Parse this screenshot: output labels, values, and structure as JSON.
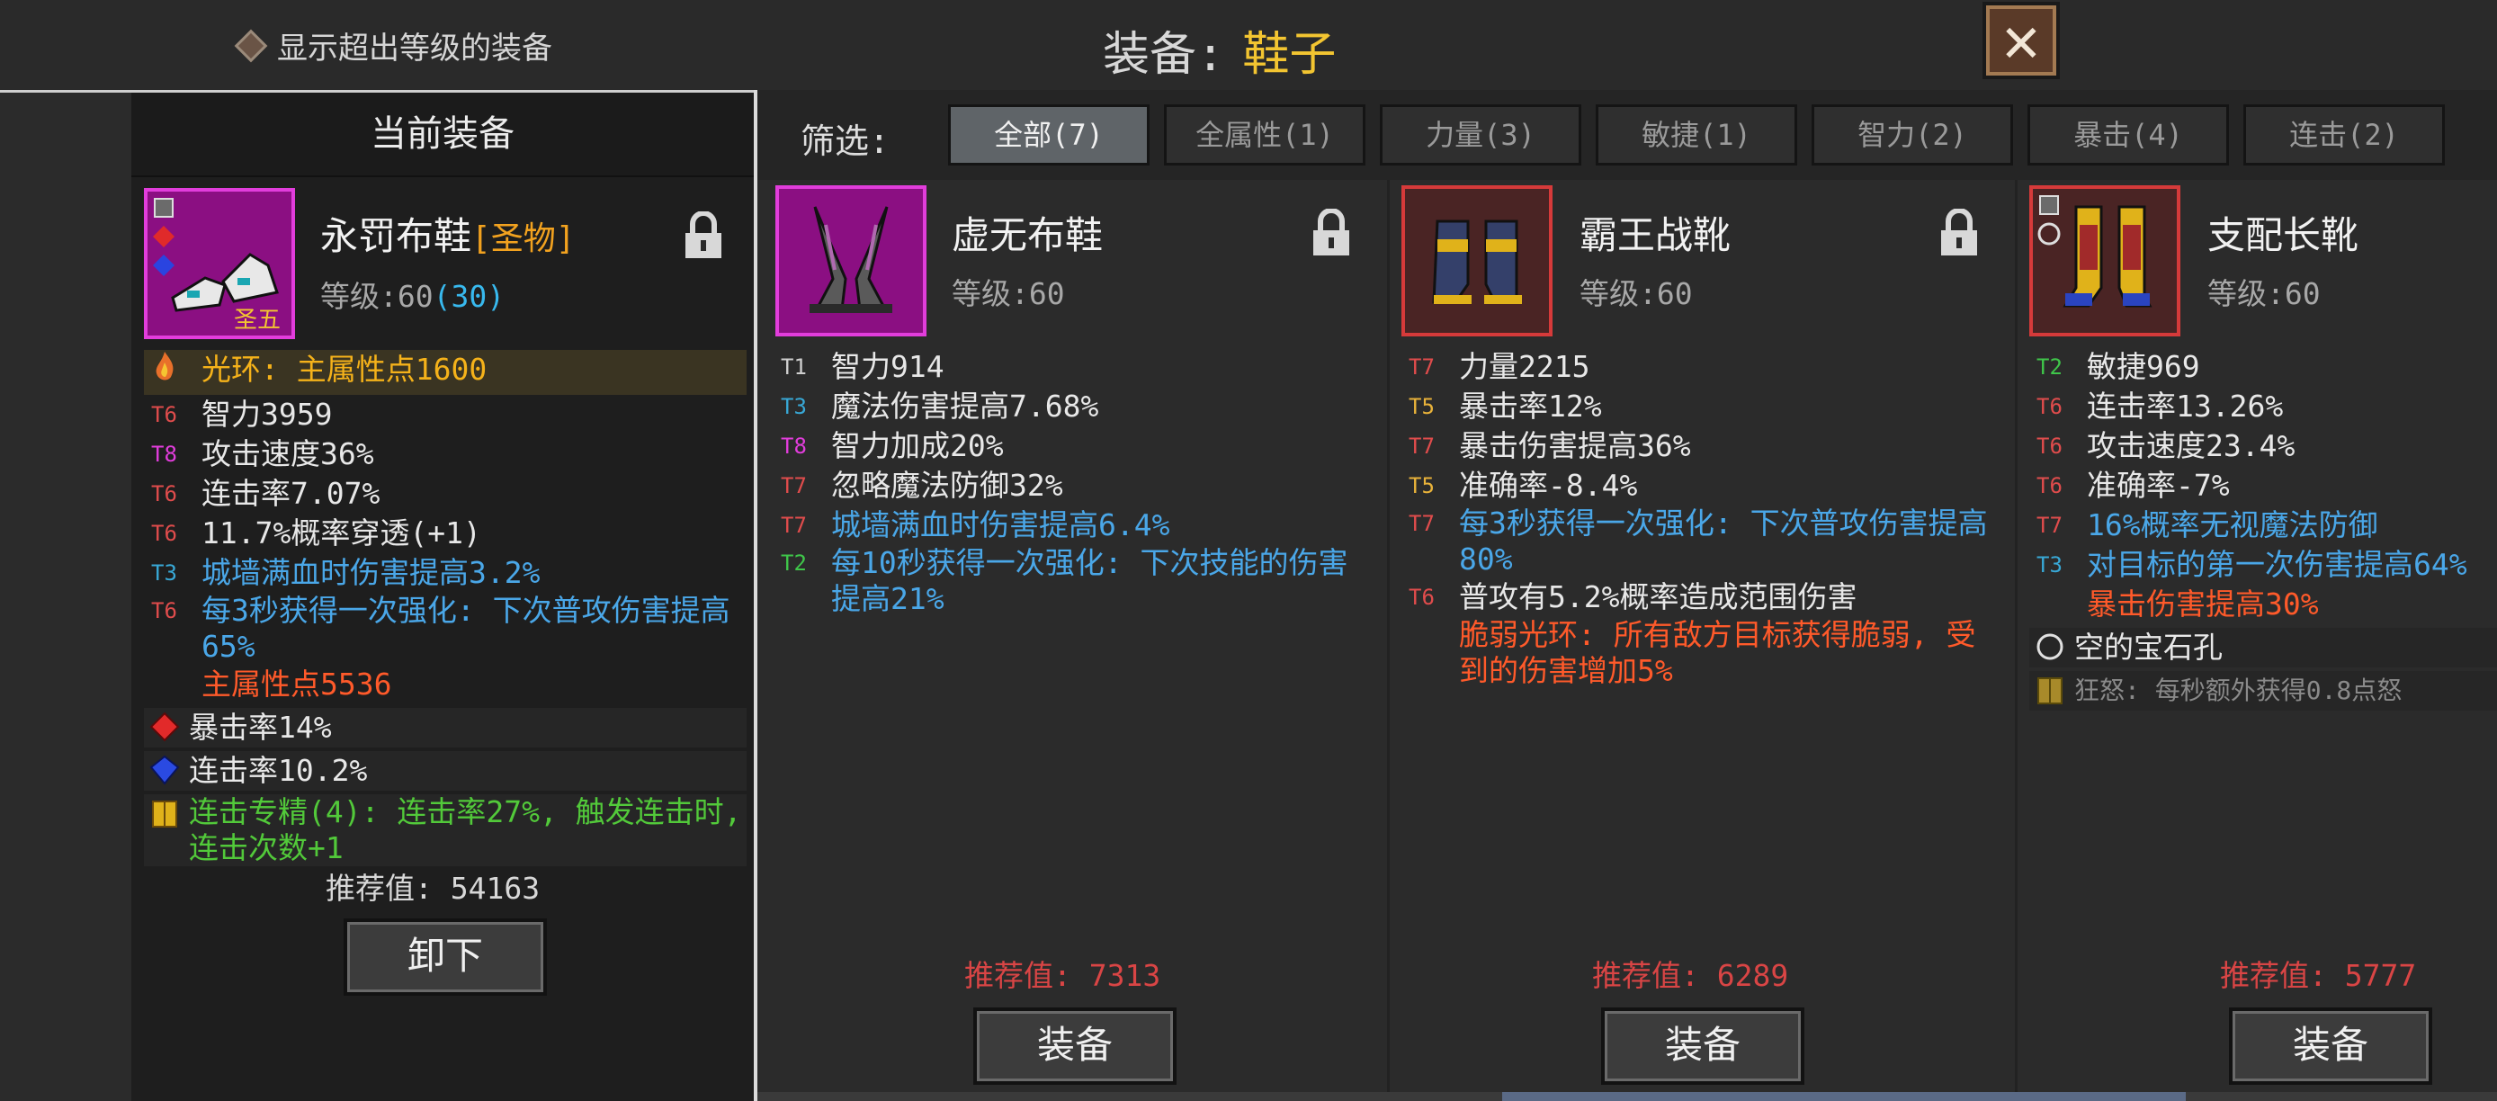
{
  "top": {
    "show_over_level": "显示超出等级的装备",
    "title_label": "装备:",
    "title_value": "鞋子",
    "close": "✕"
  },
  "current": {
    "header": "当前装备",
    "name": "永罚布鞋",
    "tag": "[圣物]",
    "level_label": "等级:60",
    "level_extra": "(30)",
    "badge": "圣五",
    "aura": "光环: 主属性点1600",
    "stats": [
      {
        "tier": "T6",
        "text": "智力3959"
      },
      {
        "tier": "T8",
        "text": "攻击速度36%"
      },
      {
        "tier": "T6",
        "text": "连击率7.07%"
      },
      {
        "tier": "T6",
        "text": "11.7%概率穿透(+1)"
      },
      {
        "tier": "T3",
        "text": "城墙满血时伤害提高3.2%"
      },
      {
        "tier": "T6",
        "text": "每3秒获得一次强化: 下次普攻伤害提高65%"
      }
    ],
    "main_attr": "主属性点5536",
    "gems": [
      "暴击率14%",
      "连击率10.2%"
    ],
    "set_bonus": "连击专精(4): 连击率27%, 触发连击时, 连击次数+1",
    "rec_label": "推荐值:",
    "rec_value": "54163",
    "button": "卸下"
  },
  "filter": {
    "label": "筛选:",
    "tabs": [
      "全部(7)",
      "全属性(1)",
      "力量(3)",
      "敏捷(1)",
      "智力(2)",
      "暴击(4)",
      "连击(2)"
    ]
  },
  "items": [
    {
      "name": "虚无布鞋",
      "level_label": "等级:60",
      "stats": [
        {
          "tier": "T1",
          "text": "智力914"
        },
        {
          "tier": "T3",
          "text": "魔法伤害提高7.68%"
        },
        {
          "tier": "T8",
          "text": "智力加成20%"
        },
        {
          "tier": "T7",
          "text": "忽略魔法防御32%"
        },
        {
          "tier": "T7",
          "text": "城墙满血时伤害提高6.4%"
        },
        {
          "tier": "T2",
          "text": "每10秒获得一次强化: 下次技能的伤害提高21%"
        }
      ],
      "rec_label": "推荐值:",
      "rec_value": "7313",
      "button": "装备"
    },
    {
      "name": "霸王战靴",
      "level_label": "等级:60",
      "stats": [
        {
          "tier": "T7",
          "text": "力量2215"
        },
        {
          "tier": "T5",
          "text": "暴击率12%"
        },
        {
          "tier": "T7",
          "text": "暴击伤害提高36%"
        },
        {
          "tier": "T5",
          "text": "准确率-8.4%"
        },
        {
          "tier": "T7",
          "text": "每3秒获得一次强化: 下次普攻伤害提高80%"
        },
        {
          "tier": "T6",
          "text": "普攻有5.2%概率造成范围伤害"
        }
      ],
      "extra": "脆弱光环: 所有敌方目标获得脆弱, 受到的伤害增加5%",
      "rec_label": "推荐值:",
      "rec_value": "6289",
      "button": "装备"
    },
    {
      "name": "支配长靴",
      "level_label": "等级:60",
      "stats": [
        {
          "tier": "T2",
          "text": "敏捷969"
        },
        {
          "tier": "T6",
          "text": "连击率13.26%"
        },
        {
          "tier": "T6",
          "text": "攻击速度23.4%"
        },
        {
          "tier": "T6",
          "text": "准确率-7%"
        },
        {
          "tier": "T7",
          "text": "16%概率无视魔法防御"
        },
        {
          "tier": "T3",
          "text": "对目标的第一次伤害提高64%"
        }
      ],
      "extra": "暴击伤害提高30%",
      "gem_slot": "空的宝石孔",
      "set_bonus": "狂怒: 每秒额外获得0.8点怒",
      "rec_label": "推荐值:",
      "rec_value": "5777",
      "button": "装备"
    }
  ]
}
